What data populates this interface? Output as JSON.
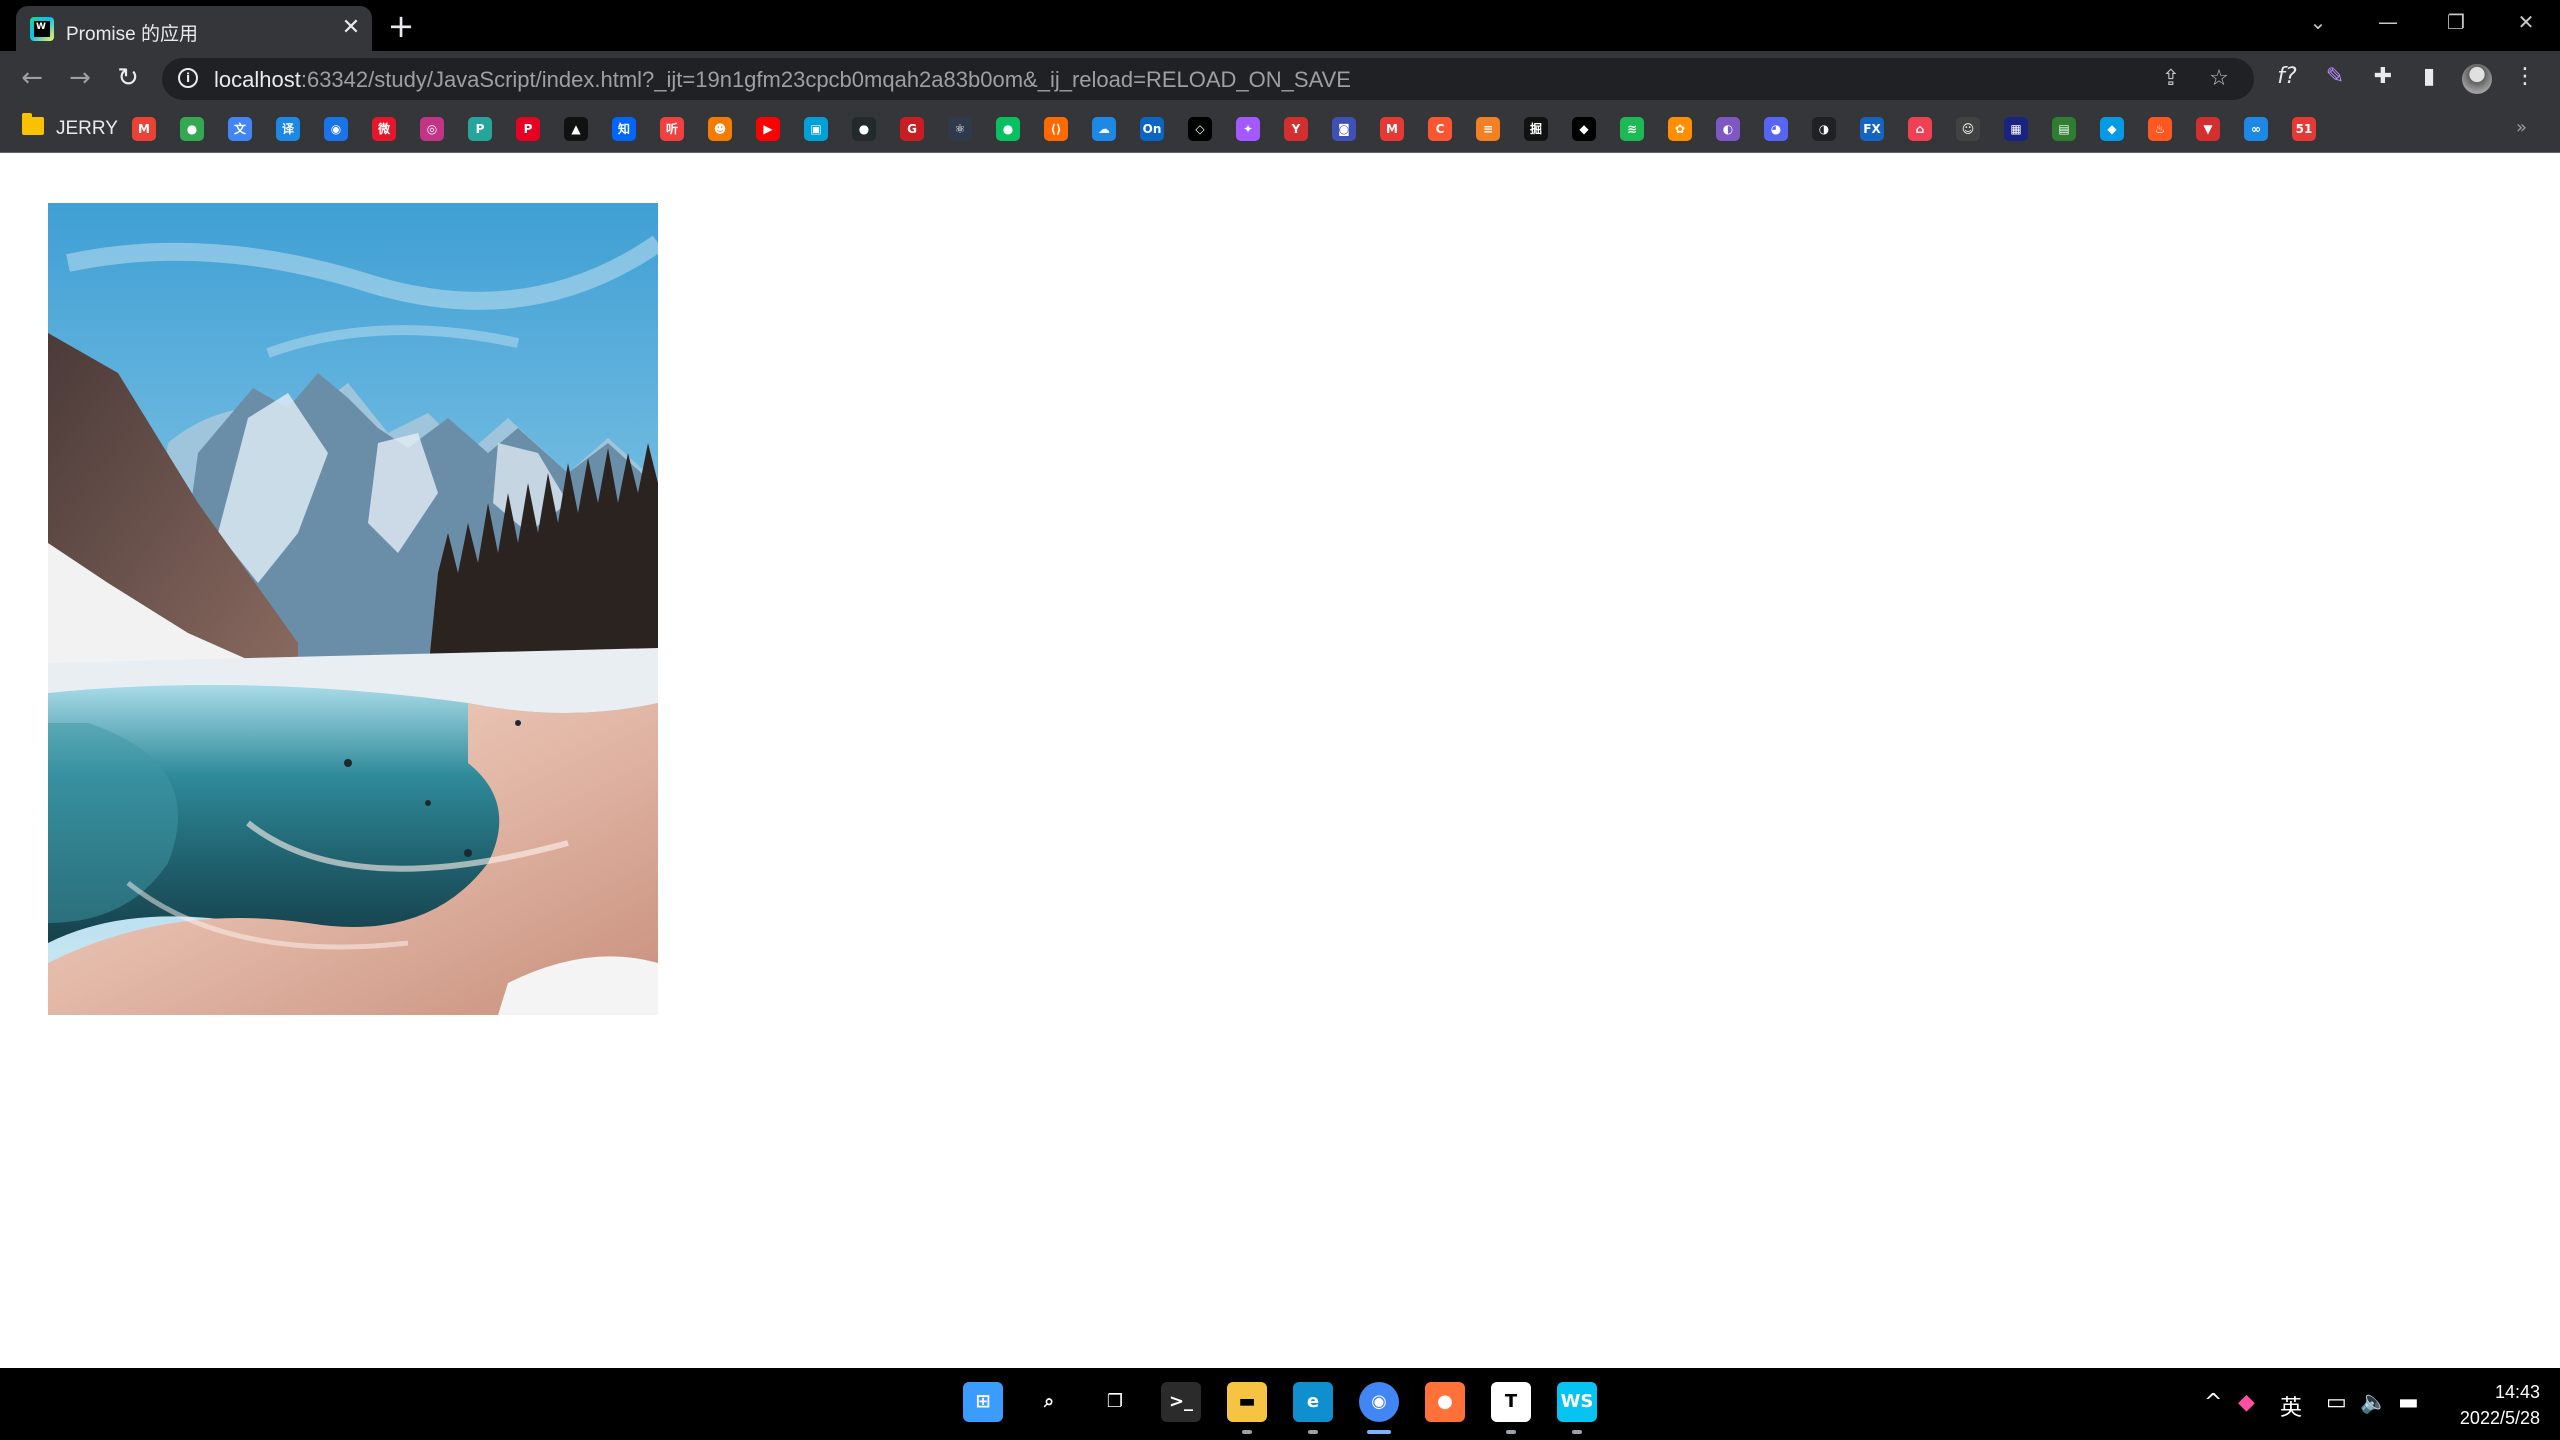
{
  "browser": {
    "tab_title": "Promise 的应用",
    "tab_close": "✕",
    "new_tab": "+",
    "window_controls": {
      "tab_search": "⌄",
      "minimize": "—",
      "restore": "❐",
      "close": "✕"
    }
  },
  "toolbar": {
    "back": "←",
    "forward": "→",
    "reload": "↻",
    "url_host": "localhost",
    "url_rest": ":63342/study/JavaScript/index.html?_ijt=19n1gfm23cpcb0mqah2a83b0om&_ij_reload=RELOAD_ON_SAVE",
    "info_icon": "i",
    "share_icon": "⇪",
    "star_icon": "☆",
    "extensions": [
      "f?",
      "✎",
      "✚",
      "▮"
    ],
    "menu": "⋮"
  },
  "bookmarks": {
    "folder_label": "JERRY",
    "items": [
      {
        "name": "gmail",
        "color": "#ea4335",
        "glyph": "M"
      },
      {
        "name": "chrome",
        "color": "#34a853",
        "glyph": "●"
      },
      {
        "name": "translate",
        "color": "#4285f4",
        "glyph": "文"
      },
      {
        "name": "dict",
        "color": "#1e88e5",
        "glyph": "译"
      },
      {
        "name": "globe",
        "color": "#1a73e8",
        "glyph": "◉"
      },
      {
        "name": "weibo",
        "color": "#e6162d",
        "glyph": "微"
      },
      {
        "name": "instagram",
        "color": "#c13584",
        "glyph": "◎"
      },
      {
        "name": "pixiv",
        "color": "#26a69a",
        "glyph": "P"
      },
      {
        "name": "pinterest",
        "color": "#e60023",
        "glyph": "P"
      },
      {
        "name": "stamp",
        "color": "#111111",
        "glyph": "▲"
      },
      {
        "name": "zhihu",
        "color": "#0066ff",
        "glyph": "知"
      },
      {
        "name": "news",
        "color": "#f04142",
        "glyph": "听"
      },
      {
        "name": "face",
        "color": "#f57c00",
        "glyph": "☻"
      },
      {
        "name": "youtube",
        "color": "#ff0000",
        "glyph": "▶"
      },
      {
        "name": "bilibili",
        "color": "#00a1d6",
        "glyph": "▣"
      },
      {
        "name": "github",
        "color": "#24292e",
        "glyph": "●"
      },
      {
        "name": "gitee",
        "color": "#c71d23",
        "glyph": "G"
      },
      {
        "name": "react",
        "color": "#2f3a4a",
        "glyph": "⚛"
      },
      {
        "name": "wechat",
        "color": "#07c160",
        "glyph": "●"
      },
      {
        "name": "code",
        "color": "#ff6a00",
        "glyph": "⟨⟩"
      },
      {
        "name": "cloud",
        "color": "#1e88e5",
        "glyph": "☁"
      },
      {
        "name": "onedrive",
        "color": "#0a66c2",
        "glyph": "On"
      },
      {
        "name": "codepen",
        "color": "#000000",
        "glyph": "◇"
      },
      {
        "name": "figma",
        "color": "#a259ff",
        "glyph": "✦"
      },
      {
        "name": "yuque",
        "color": "#d32f2f",
        "glyph": "Y"
      },
      {
        "name": "robot",
        "color": "#3f51b5",
        "glyph": "◙"
      },
      {
        "name": "mail",
        "color": "#e53935",
        "glyph": "M"
      },
      {
        "name": "csdn",
        "color": "#fc5531",
        "glyph": "C"
      },
      {
        "name": "stack",
        "color": "#f48024",
        "glyph": "≡"
      },
      {
        "name": "juejin",
        "color": "#111111",
        "glyph": "掘"
      },
      {
        "name": "chat",
        "color": "#000000",
        "glyph": "◆"
      },
      {
        "name": "spotify",
        "color": "#1db954",
        "glyph": "≋"
      },
      {
        "name": "orange",
        "color": "#ff8f00",
        "glyph": "✿"
      },
      {
        "name": "purple",
        "color": "#7e57c2",
        "glyph": "◐"
      },
      {
        "name": "discord",
        "color": "#5865f2",
        "glyph": "◕"
      },
      {
        "name": "dark",
        "color": "#202124",
        "glyph": "◑"
      },
      {
        "name": "fx",
        "color": "#1565c0",
        "glyph": "FX"
      },
      {
        "name": "pocket",
        "color": "#ef4056",
        "glyph": "⌂"
      },
      {
        "name": "ghost",
        "color": "#424242",
        "glyph": "☺"
      },
      {
        "name": "window",
        "color": "#1a237e",
        "glyph": "▦"
      },
      {
        "name": "book",
        "color": "#2e7d32",
        "glyph": "▤"
      },
      {
        "name": "diamond",
        "color": "#039be5",
        "glyph": "◆"
      },
      {
        "name": "flame",
        "color": "#ff5722",
        "glyph": "♨"
      },
      {
        "name": "shield",
        "color": "#d32f2f",
        "glyph": "▼"
      },
      {
        "name": "loop",
        "color": "#1e88e5",
        "glyph": "∞"
      },
      {
        "name": "num51",
        "color": "#e53935",
        "glyph": "51"
      }
    ],
    "more": "»"
  },
  "taskbar": {
    "apps": [
      {
        "name": "start",
        "color": "#3b9cff",
        "glyph": "⊞"
      },
      {
        "name": "search",
        "color": "#000000",
        "glyph": "⌕"
      },
      {
        "name": "taskview",
        "color": "#000000",
        "glyph": "❐"
      },
      {
        "name": "terminal",
        "color": "#2b2b2b",
        "glyph": ">_"
      },
      {
        "name": "explorer",
        "color": "#f6c343",
        "glyph": "▬"
      },
      {
        "name": "edge",
        "color": "#0f8fce",
        "glyph": "e"
      },
      {
        "name": "chrome",
        "color": "#4285f4",
        "glyph": "◉"
      },
      {
        "name": "firefox",
        "color": "#ff7139",
        "glyph": "●"
      },
      {
        "name": "typora",
        "color": "#ffffff",
        "glyph": "T"
      },
      {
        "name": "webstorm",
        "color": "#07c3f2",
        "glyph": "WS"
      }
    ],
    "tray": {
      "chevron": "^",
      "color_app": "◆",
      "ime": "英",
      "network": "▭",
      "volume": "🔈",
      "battery": "▬"
    },
    "time": "14:43",
    "date": "2022/5/28"
  }
}
